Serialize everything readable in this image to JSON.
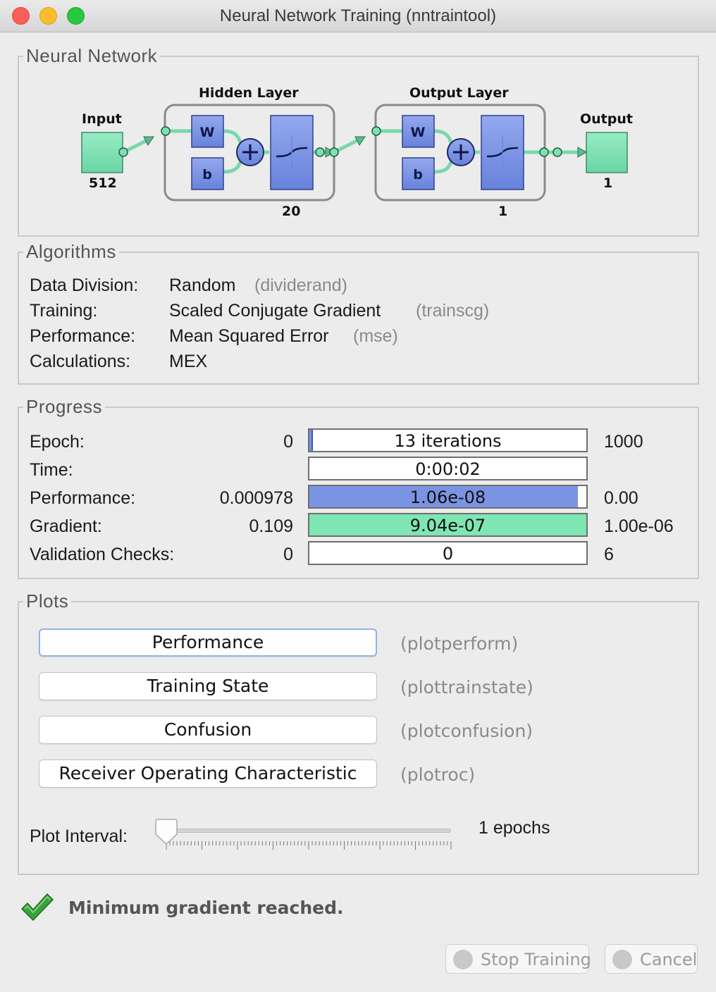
{
  "window": {
    "title": "Neural Network Training (nntraintool)"
  },
  "network": {
    "legend": "Neural Network",
    "input_label": "Input",
    "input_size": "512",
    "hidden_label": "Hidden Layer",
    "hidden_size": "20",
    "output_layer_label": "Output Layer",
    "output_layer_size": "1",
    "output_label": "Output",
    "output_size": "1",
    "weight_symbol": "W",
    "bias_symbol": "b",
    "colors": {
      "block": "#7b93e3",
      "io": "#7fe0b0",
      "link": "#78d8ad"
    }
  },
  "algorithms": {
    "legend": "Algorithms",
    "rows": [
      {
        "label": "Data Division:",
        "value": "Random",
        "fn": "(dividerand)"
      },
      {
        "label": "Training:",
        "value": "Scaled Conjugate Gradient",
        "fn": "(trainscg)"
      },
      {
        "label": "Performance:",
        "value": "Mean Squared Error",
        "fn": "(mse)"
      },
      {
        "label": "Calculations:",
        "value": "MEX",
        "fn": ""
      }
    ]
  },
  "progress": {
    "legend": "Progress",
    "rows": [
      {
        "label": "Epoch:",
        "start": "0",
        "current": "13 iterations",
        "end": "1000",
        "fill": 0.013,
        "color": "#7b93e3"
      },
      {
        "label": "Time:",
        "start": "",
        "current": "0:00:02",
        "end": "",
        "fill": 0,
        "color": "#7b93e3"
      },
      {
        "label": "Performance:",
        "start": "0.000978",
        "current": "1.06e-08",
        "end": "0.00",
        "fill": 0.97,
        "color": "#7b93e3"
      },
      {
        "label": "Gradient:",
        "start": "0.109",
        "current": "9.04e-07",
        "end": "1.00e-06",
        "fill": 1.0,
        "color": "#7ee6b3"
      },
      {
        "label": "Validation Checks:",
        "start": "0",
        "current": "0",
        "end": "6",
        "fill": 0,
        "color": "#7b93e3"
      }
    ]
  },
  "plots": {
    "legend": "Plots",
    "buttons": [
      {
        "label": "Performance",
        "fn": "(plotperform)"
      },
      {
        "label": "Training State",
        "fn": "(plottrainstate)"
      },
      {
        "label": "Confusion",
        "fn": "(plotconfusion)"
      },
      {
        "label": "Receiver Operating Characteristic",
        "fn": "(plotroc)"
      }
    ],
    "interval_label": "Plot Interval:",
    "interval_value": "1 epochs",
    "slider_fraction": 0
  },
  "status": {
    "message": "Minimum gradient reached.",
    "icon": "checkmark-icon"
  },
  "buttons": {
    "stop": "Stop Training",
    "cancel": "Cancel"
  }
}
